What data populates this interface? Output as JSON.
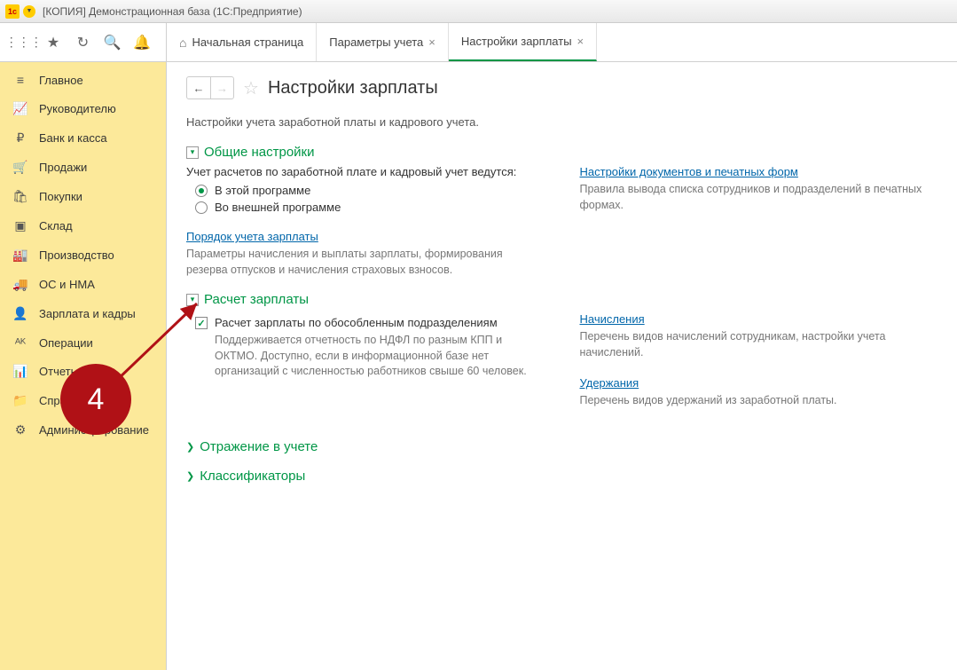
{
  "window": {
    "title": "[КОПИЯ] Демонстрационная база  (1С:Предприятие)"
  },
  "tabs": {
    "home": "Начальная страница",
    "t1": "Параметры учета",
    "t2": "Настройки зарплаты"
  },
  "sidebar": {
    "items": [
      {
        "label": "Главное",
        "icon": "≡"
      },
      {
        "label": "Руководителю",
        "icon": "📈"
      },
      {
        "label": "Банк и касса",
        "icon": "₽"
      },
      {
        "label": "Продажи",
        "icon": "🛒"
      },
      {
        "label": "Покупки",
        "icon": "🛍"
      },
      {
        "label": "Склад",
        "icon": "▣"
      },
      {
        "label": "Производство",
        "icon": "🏭"
      },
      {
        "label": "ОС и НМА",
        "icon": "🚚"
      },
      {
        "label": "Зарплата и кадры",
        "icon": "👤"
      },
      {
        "label": "Операции",
        "icon": "ᴬᴷ"
      },
      {
        "label": "Отчеты",
        "icon": "📊"
      },
      {
        "label": "Справочники",
        "icon": "📁"
      },
      {
        "label": "Администрирование",
        "icon": "⚙"
      }
    ]
  },
  "page": {
    "title": "Настройки зарплаты",
    "subtitle": "Настройки учета заработной платы и кадрового учета."
  },
  "sec_general": {
    "title": "Общие настройки",
    "label": "Учет расчетов по заработной плате и кадровый учет ведутся:",
    "opt1": "В этой программе",
    "opt2": "Во внешней программе",
    "link": "Порядок учета зарплаты",
    "desc": "Параметры начисления и выплаты зарплаты, формирования резерва отпусков и начисления страховых взносов.",
    "right_link": "Настройки документов и печатных форм",
    "right_desc": "Правила вывода списка сотрудников и подразделений в печатных формах."
  },
  "sec_calc": {
    "title": "Расчет зарплаты",
    "cb_label": "Расчет зарплаты по обособленным подразделениям",
    "cb_desc": "Поддерживается отчетность по НДФЛ по разным КПП и ОКТМО. Доступно, если в информационной базе нет организаций с численностью работников свыше 60 человек.",
    "r1_link": "Начисления",
    "r1_desc": "Перечень видов начислений сотрудникам, настройки учета начислений.",
    "r2_link": "Удержания",
    "r2_desc": "Перечень видов удержаний из заработной платы."
  },
  "sec_reflect": {
    "title": "Отражение в учете"
  },
  "sec_class": {
    "title": "Классификаторы"
  },
  "annotation": {
    "number": "4"
  }
}
